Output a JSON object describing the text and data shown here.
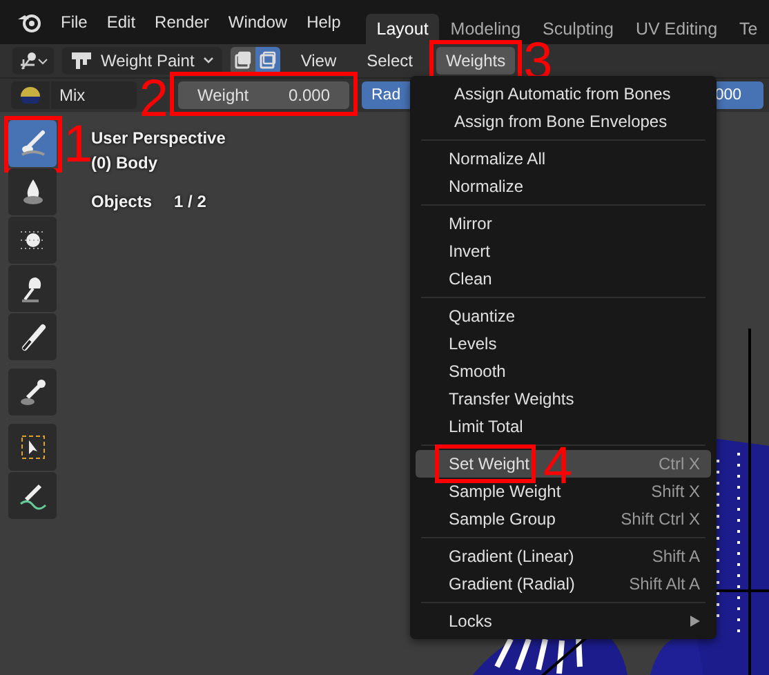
{
  "topbar": {
    "menus": [
      "File",
      "Edit",
      "Render",
      "Window",
      "Help"
    ],
    "workspaces": [
      {
        "label": "Layout",
        "selected": true
      },
      {
        "label": "Modeling",
        "selected": false
      },
      {
        "label": "Sculpting",
        "selected": false
      },
      {
        "label": "UV Editing",
        "selected": false
      },
      {
        "label": "Te",
        "selected": false
      }
    ]
  },
  "header": {
    "mode": "Weight Paint",
    "select_modes": [
      {
        "selected": false
      },
      {
        "selected": true
      }
    ],
    "menus": [
      {
        "label": "View",
        "open": false
      },
      {
        "label": "Select",
        "open": false
      },
      {
        "label": "Weights",
        "open": true,
        "annotation": "3"
      }
    ]
  },
  "tool_settings": {
    "blend": "Mix",
    "weight": {
      "label": "Weight",
      "value": "0.000",
      "annotation": "2"
    },
    "radius": {
      "label": "Rad",
      "value": "000"
    }
  },
  "toolbar": [
    [
      {
        "kind": "draw",
        "selected": true,
        "annotation": "1"
      },
      {
        "kind": "blur",
        "selected": false
      },
      {
        "kind": "average",
        "selected": false
      },
      {
        "kind": "smear",
        "selected": false
      },
      {
        "kind": "gradient",
        "selected": false
      }
    ],
    [
      {
        "kind": "sample",
        "selected": false
      }
    ],
    [
      {
        "kind": "select",
        "selected": false
      },
      {
        "kind": "annotate",
        "selected": false
      }
    ]
  ],
  "viewport": {
    "lines": [
      "User Perspective",
      "(0) Body"
    ],
    "stats": {
      "label": "Objects",
      "value": "1 / 2"
    },
    "background": {
      "kind": "picture"
    }
  },
  "menu": {
    "groups": [
      [
        {
          "label": "Assign Automatic from Bones",
          "selected": false
        },
        {
          "label": "Assign from Bone Envelopes",
          "selected": false
        }
      ],
      [
        {
          "label": "Normalize All",
          "selected": false
        },
        {
          "label": "Normalize",
          "selected": false
        }
      ],
      [
        {
          "label": "Mirror",
          "selected": false
        },
        {
          "label": "Invert",
          "selected": false
        },
        {
          "label": "Clean",
          "selected": false
        }
      ],
      [
        {
          "label": "Quantize",
          "selected": false
        },
        {
          "label": "Levels",
          "selected": false
        },
        {
          "label": "Smooth",
          "selected": false
        },
        {
          "label": "Transfer Weights",
          "selected": false
        },
        {
          "label": "Limit Total",
          "selected": false
        }
      ],
      [
        {
          "label": "Set Weight",
          "shortcut": "Ctrl X",
          "selected": true,
          "annotation": "4"
        },
        {
          "label": "Sample Weight",
          "shortcut": "Shift X",
          "selected": false
        },
        {
          "label": "Sample Group",
          "shortcut": "Shift Ctrl X",
          "selected": false
        }
      ],
      [
        {
          "label": "Gradient (Linear)",
          "shortcut": "Shift A",
          "selected": false
        },
        {
          "label": "Gradient (Radial)",
          "shortcut": "Shift Alt A",
          "selected": false
        }
      ],
      [
        {
          "label": "Locks",
          "submenu": true,
          "selected": false
        }
      ]
    ]
  }
}
